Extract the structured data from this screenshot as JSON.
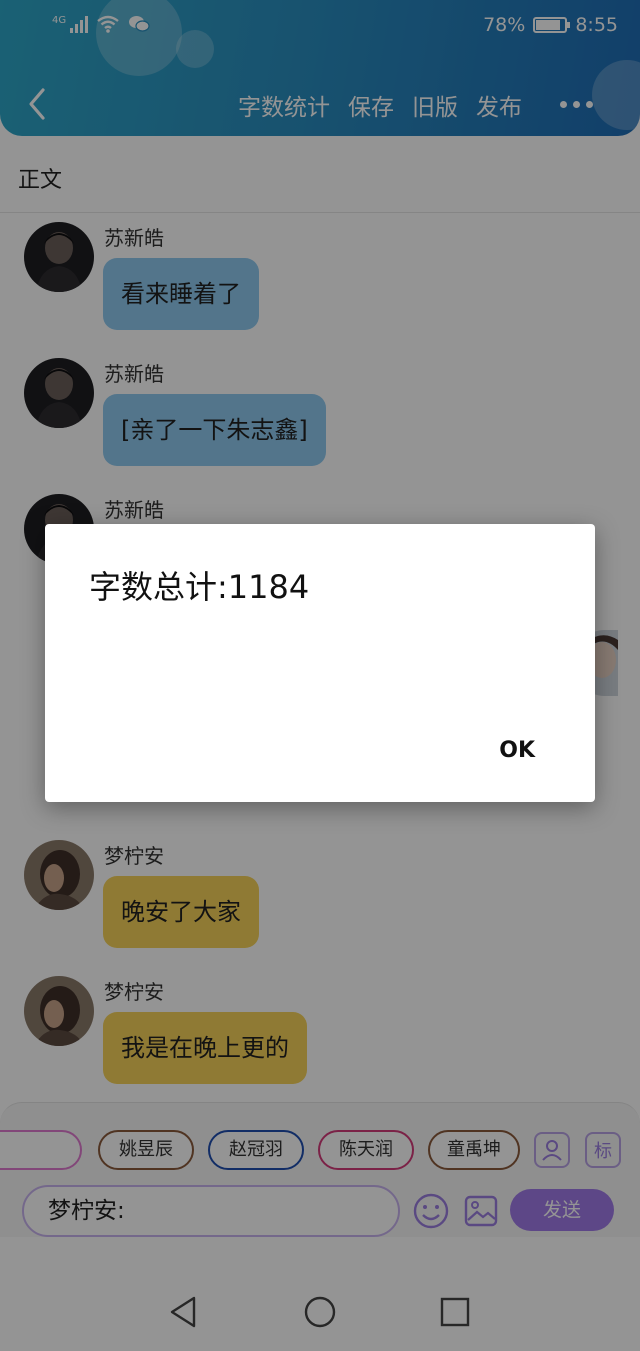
{
  "status_bar": {
    "network": "4G",
    "battery": "78%",
    "battery_level": 0.78,
    "time": "8:55"
  },
  "header": {
    "actions": [
      "字数统计",
      "保存",
      "旧版",
      "发布"
    ]
  },
  "content": {
    "section_title": "正文"
  },
  "messages": [
    {
      "sender": "苏新皓",
      "text": "看来睡着了",
      "bubble_color": "#8fcaf0"
    },
    {
      "sender": "苏新皓",
      "text": "[亲了一下朱志鑫]",
      "bubble_color": "#8fcaf0"
    },
    {
      "sender": "苏新皓",
      "text": ""
    },
    {
      "sender": "梦柠安",
      "text": "晚安了大家",
      "bubble_color": "#f6d35a"
    },
    {
      "sender": "梦柠安",
      "text": "我是在晚上更的",
      "bubble_color": "#f6d35a"
    }
  ],
  "character_chips": [
    {
      "label": "",
      "color": "#e07ad0"
    },
    {
      "label": "姚昱辰",
      "color": "#8a5a3c"
    },
    {
      "label": "赵冠羽",
      "color": "#1f4fb0"
    },
    {
      "label": "陈天润",
      "color": "#d43b7a"
    },
    {
      "label": "童禹坤",
      "color": "#8a5a3c"
    }
  ],
  "tools": {
    "person_icon": "person-icon",
    "tag_label": "标"
  },
  "input": {
    "value": "梦柠安:",
    "send_label": "发送"
  },
  "dialog": {
    "message": "字数总计:1184",
    "ok_label": "OK"
  },
  "colors": {
    "header_start": "#2ea7c8",
    "header_end": "#1f6db6",
    "accent_purple": "#a07be8"
  }
}
